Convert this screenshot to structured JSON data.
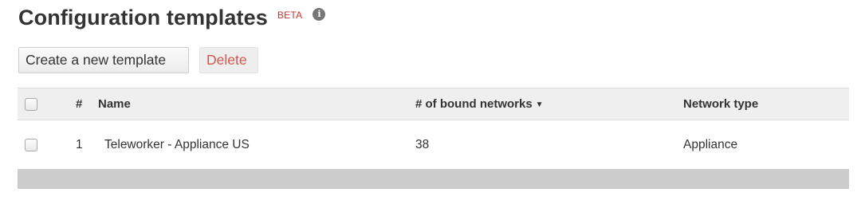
{
  "header": {
    "title": "Configuration templates",
    "badge": "BETA",
    "info_icon": "info-circle-icon"
  },
  "toolbar": {
    "create_label": "Create a new template",
    "delete_label": "Delete",
    "delete_color": "#d9534f"
  },
  "table": {
    "columns": {
      "number": "#",
      "name": "Name",
      "bound_networks": "# of bound networks",
      "network_type": "Network type"
    },
    "sort_indicator": "▼",
    "rows": [
      {
        "number": "1",
        "name": "Teleworker - Appliance US",
        "bound_networks": "38",
        "network_type": "Appliance"
      }
    ]
  },
  "colors": {
    "beta_badge": "#d0312d",
    "header_row_bg": "#efefef",
    "footer_bar_bg": "#cccccc"
  }
}
